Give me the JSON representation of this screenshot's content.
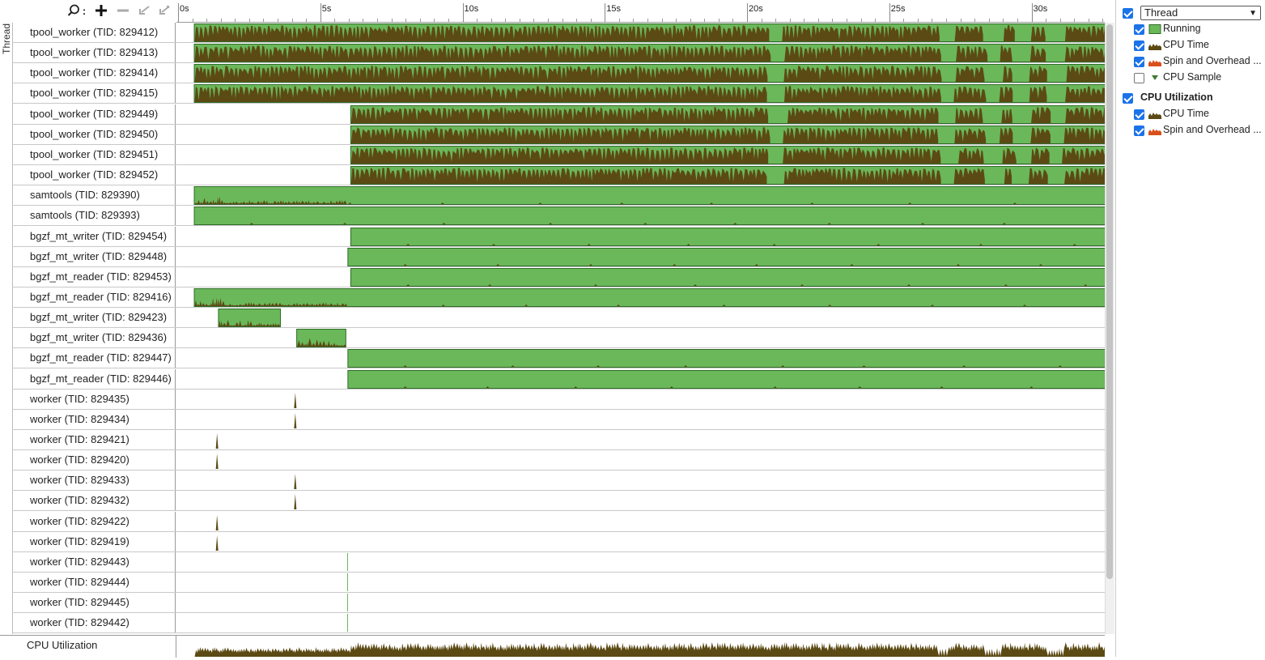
{
  "colors": {
    "running": "#6ab85a",
    "running_border": "#2f6b27",
    "cpu_time": "#5c4a14",
    "spin": "#d8501c",
    "check": "#1a73e8"
  },
  "toolbar": {
    "search_icon": "magnifier-icon",
    "zoom_in_icon": "plus-icon",
    "zoom_out_icon": "minus-icon",
    "undo_zoom_icon": "undo-zoom-icon",
    "reset_zoom_icon": "reset-zoom-icon"
  },
  "ruler": {
    "ticks": [
      "0s",
      "5s",
      "10s",
      "15s",
      "20s",
      "25s",
      "30s"
    ],
    "tick_seconds": [
      0,
      5,
      10,
      15,
      20,
      25,
      30
    ],
    "range_seconds": [
      0,
      32.6
    ]
  },
  "group_label": "Thread",
  "threads": [
    {
      "name": "tpool_worker (TID: 829412)",
      "start": 0.3,
      "end": 32.6,
      "kind": "busy"
    },
    {
      "name": "tpool_worker (TID: 829413)",
      "start": 0.3,
      "end": 32.6,
      "kind": "busy"
    },
    {
      "name": "tpool_worker (TID: 829414)",
      "start": 0.3,
      "end": 32.6,
      "kind": "busy"
    },
    {
      "name": "tpool_worker (TID: 829415)",
      "start": 0.3,
      "end": 32.6,
      "kind": "busy"
    },
    {
      "name": "tpool_worker (TID: 829449)",
      "start": 5.8,
      "end": 32.6,
      "kind": "busy"
    },
    {
      "name": "tpool_worker (TID: 829450)",
      "start": 5.8,
      "end": 32.6,
      "kind": "busy"
    },
    {
      "name": "tpool_worker (TID: 829451)",
      "start": 5.8,
      "end": 32.6,
      "kind": "busy"
    },
    {
      "name": "tpool_worker (TID: 829452)",
      "start": 5.8,
      "end": 32.6,
      "kind": "busy"
    },
    {
      "name": "samtools (TID: 829390)",
      "start": 0.3,
      "end": 32.6,
      "kind": "light"
    },
    {
      "name": "samtools (TID: 829393)",
      "start": 0.3,
      "end": 32.6,
      "kind": "idle"
    },
    {
      "name": "bgzf_mt_writer (TID: 829454)",
      "start": 5.8,
      "end": 32.6,
      "kind": "idle"
    },
    {
      "name": "bgzf_mt_writer (TID: 829448)",
      "start": 5.7,
      "end": 32.5,
      "kind": "idle"
    },
    {
      "name": "bgzf_mt_reader (TID: 829453)",
      "start": 5.8,
      "end": 32.6,
      "kind": "idle"
    },
    {
      "name": "bgzf_mt_reader (TID: 829416)",
      "start": 0.3,
      "end": 32.6,
      "kind": "light"
    },
    {
      "name": "bgzf_mt_writer (TID: 829423)",
      "start": 1.15,
      "end": 3.3,
      "kind": "light"
    },
    {
      "name": "bgzf_mt_writer (TID: 829436)",
      "start": 3.9,
      "end": 5.6,
      "kind": "light"
    },
    {
      "name": "bgzf_mt_reader (TID: 829447)",
      "start": 5.7,
      "end": 32.45,
      "kind": "idle"
    },
    {
      "name": "bgzf_mt_reader (TID: 829446)",
      "start": 5.7,
      "end": 32.4,
      "kind": "idle"
    },
    {
      "name": "worker (TID: 829435)",
      "start": 3.85,
      "end": 3.87,
      "kind": "spike"
    },
    {
      "name": "worker (TID: 829434)",
      "start": 3.85,
      "end": 3.87,
      "kind": "spike"
    },
    {
      "name": "worker (TID: 829421)",
      "start": 1.1,
      "end": 1.12,
      "kind": "spike"
    },
    {
      "name": "worker (TID: 829420)",
      "start": 1.1,
      "end": 1.12,
      "kind": "spike"
    },
    {
      "name": "worker (TID: 829433)",
      "start": 3.85,
      "end": 3.87,
      "kind": "spike"
    },
    {
      "name": "worker (TID: 829432)",
      "start": 3.85,
      "end": 3.87,
      "kind": "spike"
    },
    {
      "name": "worker (TID: 829422)",
      "start": 1.1,
      "end": 1.12,
      "kind": "spike"
    },
    {
      "name": "worker (TID: 829419)",
      "start": 1.1,
      "end": 1.12,
      "kind": "spike"
    },
    {
      "name": "worker (TID: 829443)",
      "start": 5.69,
      "end": 5.71,
      "kind": "line"
    },
    {
      "name": "worker (TID: 829444)",
      "start": 5.69,
      "end": 5.71,
      "kind": "line"
    },
    {
      "name": "worker (TID: 829445)",
      "start": 5.69,
      "end": 5.71,
      "kind": "line"
    },
    {
      "name": "worker (TID: 829442)",
      "start": 5.69,
      "end": 5.71,
      "kind": "line"
    }
  ],
  "cpu_utilization_label": "CPU Utilization",
  "legend": {
    "thread_group": {
      "checked": true,
      "select_value": "Thread"
    },
    "thread_items": [
      {
        "label": "Running",
        "checked": true,
        "icon": "running-swatch-icon"
      },
      {
        "label": "CPU Time",
        "checked": true,
        "icon": "cpu-time-swatch-icon"
      },
      {
        "label": "Spin and Overhead ...",
        "checked": true,
        "icon": "spin-overhead-swatch-icon"
      },
      {
        "label": "CPU Sample",
        "checked": false,
        "icon": "cpu-sample-marker-icon"
      }
    ],
    "cpu_group": {
      "checked": true,
      "label": "CPU Utilization"
    },
    "cpu_items": [
      {
        "label": "CPU Time",
        "checked": true,
        "icon": "cpu-time-swatch-icon"
      },
      {
        "label": "Spin and Overhead ...",
        "checked": true,
        "icon": "spin-overhead-swatch-icon"
      }
    ]
  }
}
